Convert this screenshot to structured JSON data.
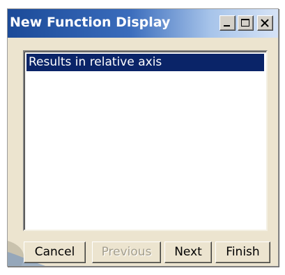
{
  "window": {
    "title": "New Function Display",
    "controls": {
      "minimize_icon": "minimize-icon",
      "maximize_icon": "maximize-icon",
      "close_icon": "close-icon"
    }
  },
  "list": {
    "items": [
      {
        "label": "Results in relative axis",
        "selected": true
      }
    ]
  },
  "buttons": {
    "cancel": "Cancel",
    "previous": "Previous",
    "next": "Next",
    "finish": "Finish"
  },
  "colors": {
    "titlebar_start": "#1b4a98",
    "titlebar_end": "#d6e3f6",
    "dialog_bg": "#ece4cf",
    "selection_bg": "#0a2468",
    "disabled_text": "#a39e8e"
  }
}
